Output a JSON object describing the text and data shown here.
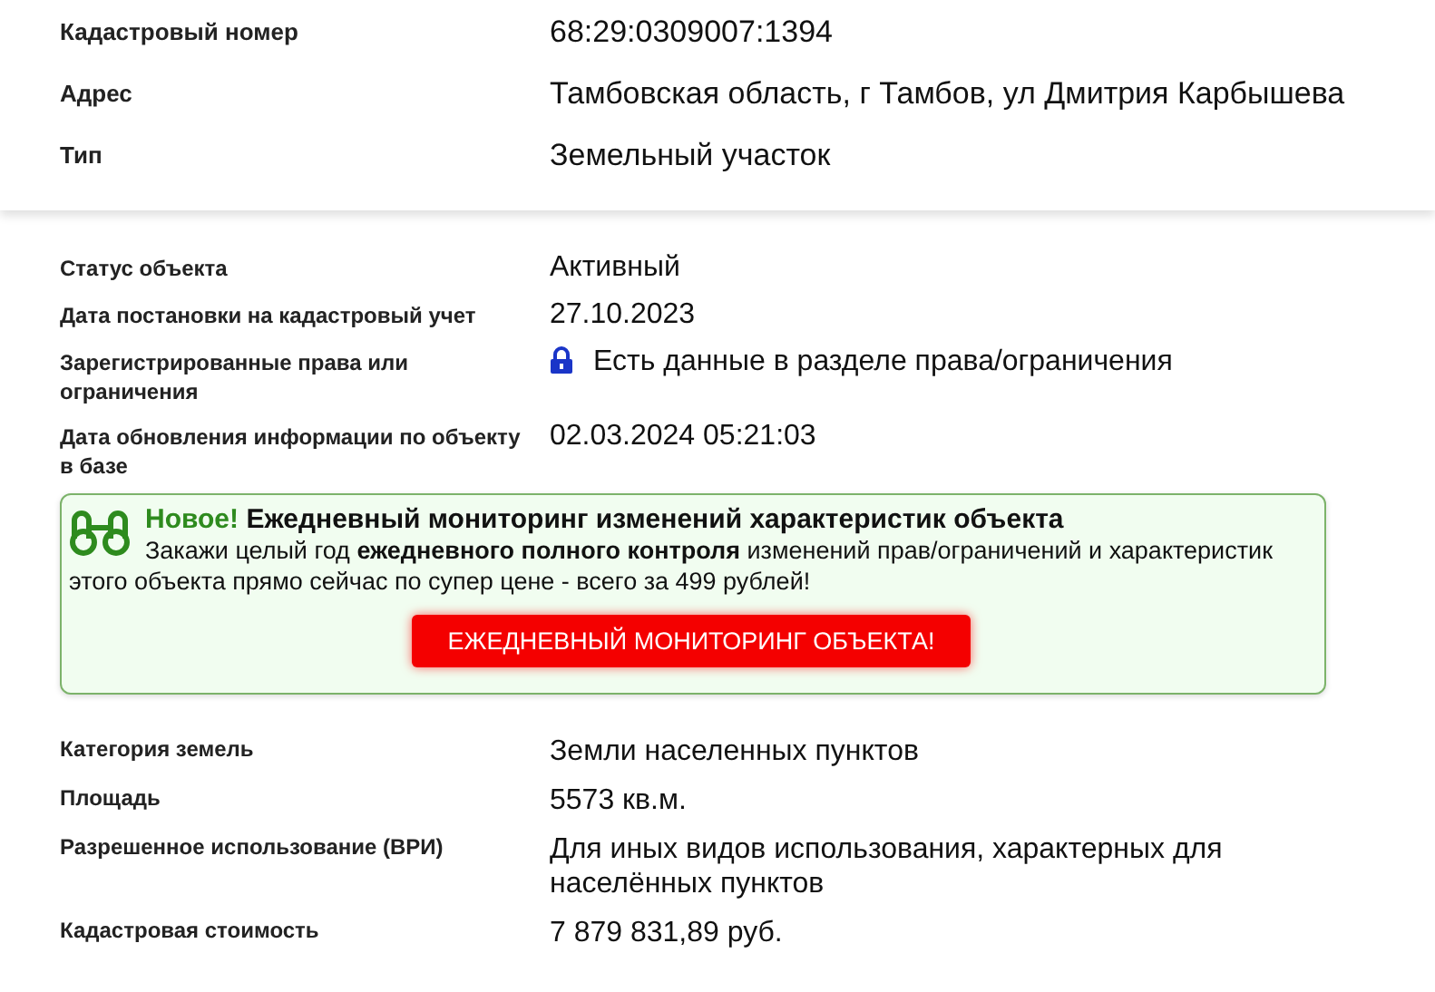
{
  "header_rows": [
    {
      "label": "Кадастровый номер",
      "value": "68:29:0309007:1394"
    },
    {
      "label": "Адрес",
      "value": "Тамбовская область, г Тамбов, ул Дмитрия Карбышева"
    },
    {
      "label": "Тип",
      "value": "Земельный участок"
    }
  ],
  "status_rows": [
    {
      "label": "Статус объекта",
      "value": "Активный",
      "kind": "plain"
    },
    {
      "label": "Дата постановки на кадастровый учет",
      "value": "27.10.2023",
      "kind": "plain"
    },
    {
      "label": "Зарегистрированные права или ограничения",
      "value": "Есть данные в разделе права/ограничения",
      "kind": "locked"
    },
    {
      "label": "Дата обновления информации по объекту в базе",
      "value": "02.03.2024 05:21:03",
      "kind": "plain"
    }
  ],
  "promo": {
    "badge": "Новое!",
    "title": "Ежедневный мониторинг изменений характеристик объекта",
    "text": "Закажи целый год **ежедневного полного контроля** изменений прав/ограничений и характеристик этого объекта прямо сейчас по супер цене - всего за 499 рублей!",
    "button": "ЕЖЕДНЕВНЫЙ МОНИТОРИНГ ОБЪЕКТА!"
  },
  "detail_rows": [
    {
      "label": "Категория земель",
      "value": "Земли населенных пунктов"
    },
    {
      "label": "Площадь",
      "value": "5573 кв.м."
    },
    {
      "label": "Разрешенное использование (ВРИ)",
      "value": "Для иных видов использования, характерных для населённых пунктов"
    },
    {
      "label": "Кадастровая стоимость",
      "value": "7 879 831,89 руб."
    }
  ]
}
